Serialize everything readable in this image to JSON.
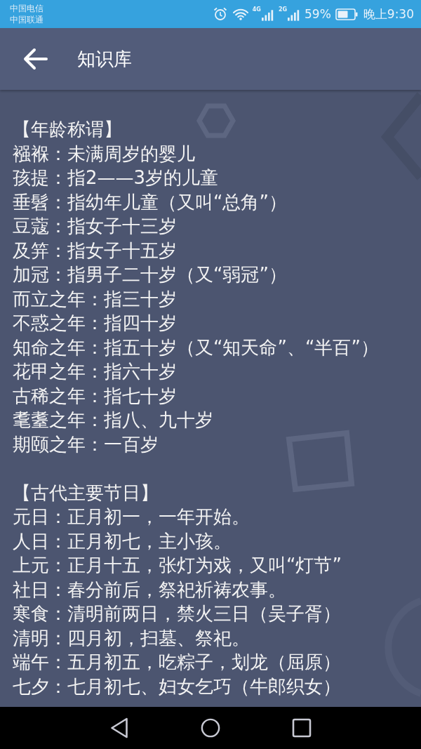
{
  "status_bar": {
    "carriers": [
      "中国电信",
      "中国联通"
    ],
    "network_labels": [
      "4G",
      "2G"
    ],
    "battery": "59%",
    "time": "晚上9:30"
  },
  "app_bar": {
    "title": "知识库"
  },
  "sections": [
    {
      "heading": "【年龄称谓】",
      "lines": [
        "襁褓：未满周岁的婴儿",
        "孩提：指2——3岁的儿童",
        "垂髫：指幼年儿童（又叫“总角”）",
        "豆蔻：指女子十三岁",
        "及笄：指女子十五岁",
        "加冠：指男子二十岁（又“弱冠”）",
        "而立之年：指三十岁",
        "不惑之年：指四十岁",
        "知命之年：指五十岁（又“知天命”、“半百”）",
        "花甲之年：指六十岁",
        "古稀之年：指七十岁",
        "耄耋之年：指八、九十岁",
        "期颐之年：一百岁"
      ]
    },
    {
      "heading": "【古代主要节日】",
      "lines": [
        "元日：正月初一，一年开始。",
        "人日：正月初七，主小孩。",
        "上元：正月十五，张灯为戏，又叫“灯节”",
        "社日：春分前后，祭祀祈祷农事。",
        "寒食：清明前两日，禁火三日（吴子胥）",
        "清明：四月初，扫墓、祭祀。",
        "端午：五月初五，吃粽子，划龙（屈原）",
        "七夕：七月初七、妇女乞巧（牛郎织女）"
      ]
    }
  ]
}
